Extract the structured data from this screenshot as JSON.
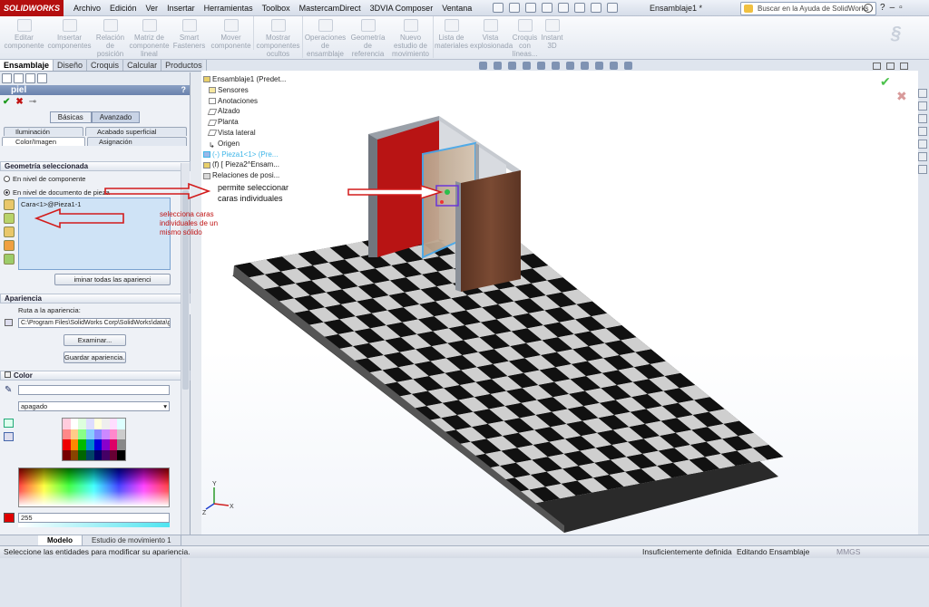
{
  "app": {
    "logo": "SOLIDWORKS",
    "doc_title": "Ensamblaje1 *"
  },
  "menu": [
    "Archivo",
    "Edición",
    "Ver",
    "Insertar",
    "Herramientas",
    "Toolbox",
    "MastercamDirect",
    "3DVIA Composer",
    "Ventana"
  ],
  "help_search": {
    "placeholder": "Buscar en la Ayuda de SolidWorks"
  },
  "ribbon": [
    {
      "label": "Editar componente"
    },
    {
      "label": "Insertar componentes"
    },
    {
      "label": "Relación de posición"
    },
    {
      "label": "Matriz de componente lineal"
    },
    {
      "label": "Smart Fasteners"
    },
    {
      "label": "Mover componente"
    },
    {
      "label": "Mostrar componentes ocultos"
    },
    {
      "label": "Operaciones de ensamblaje"
    },
    {
      "label": "Geometría de referencia"
    },
    {
      "label": "Nuevo estudio de movimiento"
    },
    {
      "label": "Lista de materiales"
    },
    {
      "label": "Vista explosionada"
    },
    {
      "label": "Croquis con líneas..."
    },
    {
      "label": "Instant 3D"
    }
  ],
  "cm_tabs": [
    "Ensamblaje",
    "Diseño",
    "Croquis",
    "Calcular",
    "Productos Office"
  ],
  "pm": {
    "title": "piel",
    "help": "?",
    "seg": [
      "Básicas",
      "Avanzado"
    ],
    "tabs": [
      "Iluminación",
      "Acabado superficial",
      "Color/Imagen",
      "Asignación"
    ],
    "geometry": {
      "header": "Geometría seleccionada",
      "radio1": "En nivel de componente",
      "radio2": "En nivel de documento de pieza",
      "selection": "Cara<1>@Pieza1-1",
      "remove_btn": "iminar todas las aparienci"
    },
    "appearance": {
      "header": "Apariencia",
      "path_label": "Ruta a la apariencia:",
      "path_value": "C:\\Program Files\\SolidWorks Corp\\SolidWorks\\data\\g",
      "browse": "Examinar...",
      "save": "Guardar apariencia..."
    },
    "color": {
      "header": "Color",
      "dropdown": "apagado",
      "value": "255"
    }
  },
  "annotations": {
    "left": [
      "selecciona caras",
      "individuales de un",
      "mismo sólido"
    ],
    "right": [
      "permite seleccionar",
      "caras individuales"
    ]
  },
  "tree": {
    "root": "Ensamblaje1  (Predet...",
    "items": [
      "Sensores",
      "Anotaciones",
      "Alzado",
      "Planta",
      "Vista lateral",
      "Origen",
      "(-) Pieza1<1> (Pre...",
      "(f) [ Pieza2^Ensam...",
      "Relaciones de posi..."
    ]
  },
  "bottom_tabs": [
    "Modelo",
    "Estudio de movimiento 1"
  ],
  "status": {
    "left": "Seleccione las entidades para modificar su apariencia.",
    "def": "Insuficientemente definida",
    "mode": "Editando Ensamblaje",
    "units": "MMGS"
  },
  "triad": {
    "x": "X",
    "y": "Y",
    "z": "Z"
  },
  "colors": {
    "accent": "#6a82ad",
    "ok": "#1d9a1d",
    "cancel": "#c01414",
    "annotation": "#c01414",
    "selected_tree": "#3cb5e8"
  }
}
